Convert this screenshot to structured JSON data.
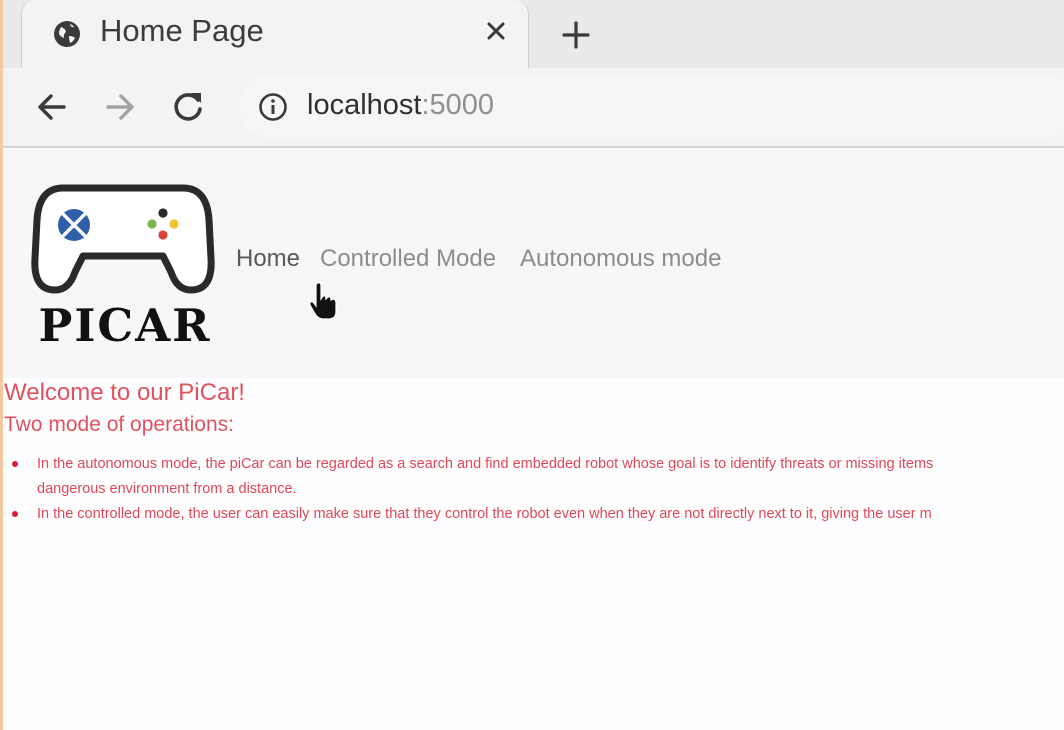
{
  "browser": {
    "tab_title": "Home Page",
    "tab_icon": "globe-icon",
    "url_host": "localhost",
    "url_port": ":5000",
    "nav_icons": [
      "back-arrow-icon",
      "forward-arrow-icon",
      "reload-icon"
    ]
  },
  "site": {
    "logo_text": "PICAR",
    "nav": [
      {
        "label": "Home",
        "active": true
      },
      {
        "label": "Controlled Mode",
        "active": false
      },
      {
        "label": "Autonomous mode",
        "active": false
      }
    ]
  },
  "content": {
    "heading": "Welcome to our PiCar!",
    "subheading": "Two mode of operations:",
    "modes": [
      {
        "line1": "In the autonomous mode, the piCar can be regarded as a search and find embedded robot whose goal is to identify threats or missing items",
        "line2": "dangerous environment from a distance."
      },
      {
        "line1": "In the controlled mode, the user can easily make sure that they control the robot even when they are not directly next to it, giving the user m",
        "line2": ""
      }
    ]
  },
  "colors": {
    "accent_text": "#e05260",
    "bullet": "#d81b3a",
    "logo_blue": "#2f5fa8"
  }
}
